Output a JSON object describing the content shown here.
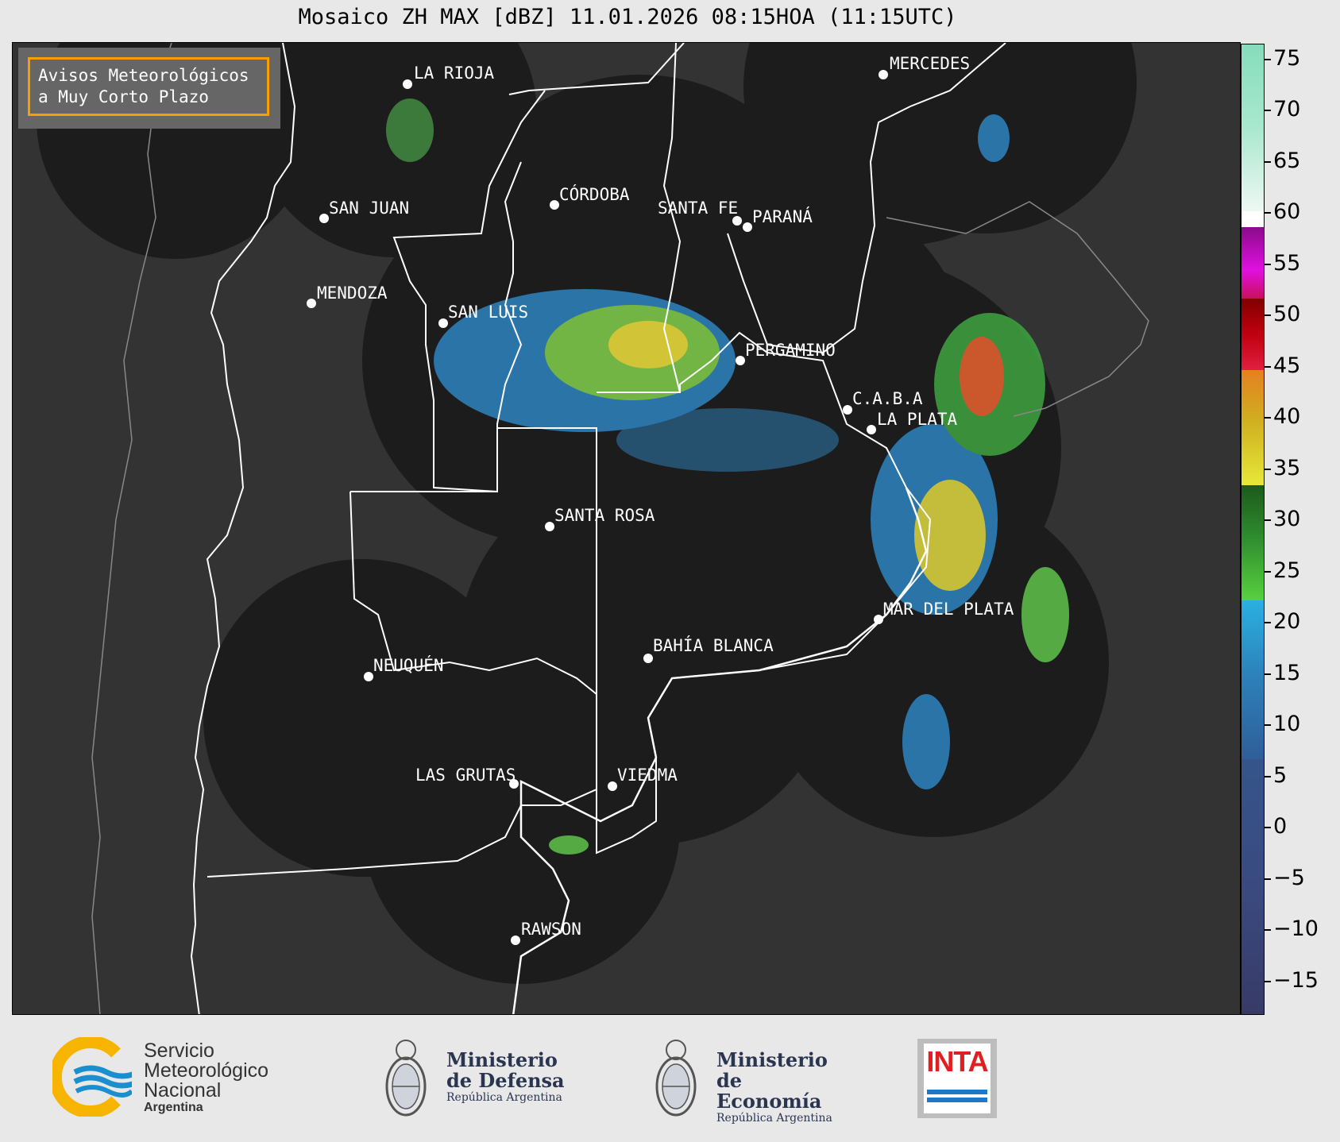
{
  "title": "Mosaico ZH MAX [dBZ] 11.01.2026 08:15HOA (11:15UTC)",
  "badge": {
    "line1": "Avisos Meteorológicos",
    "line2": "a Muy Corto Plazo"
  },
  "cities": [
    {
      "name": "LA RIOJA"
    },
    {
      "name": "MERCEDES"
    },
    {
      "name": "SAN JUAN"
    },
    {
      "name": "CÓRDOBA"
    },
    {
      "name": "SANTA FE"
    },
    {
      "name": "PARANÁ"
    },
    {
      "name": "MENDOZA"
    },
    {
      "name": "SAN LUIS"
    },
    {
      "name": "PERGAMINO"
    },
    {
      "name": "C.A.B.A"
    },
    {
      "name": "LA PLATA"
    },
    {
      "name": "SANTA ROSA"
    },
    {
      "name": "MAR DEL PLATA"
    },
    {
      "name": "BAHÍA BLANCA"
    },
    {
      "name": "NEUQUÉN"
    },
    {
      "name": "LAS GRUTAS"
    },
    {
      "name": "VIEDMA"
    },
    {
      "name": "RAWSON"
    }
  ],
  "colorbar": {
    "unit": "dBZ",
    "ticks": [
      "75",
      "70",
      "65",
      "60",
      "55",
      "50",
      "45",
      "40",
      "35",
      "30",
      "25",
      "20",
      "15",
      "10",
      "5",
      "0",
      "−5",
      "−10",
      "−15"
    ]
  },
  "logos": {
    "smn": {
      "line1": "Servicio",
      "line2": "Meteorológico",
      "line3": "Nacional",
      "line4": "Argentina",
      "icon": "smn-logo-icon"
    },
    "defensa": {
      "line1": "Ministerio",
      "line2": "de Defensa",
      "sub": "República Argentina",
      "icon": "argentina-coat-of-arms-icon"
    },
    "economia": {
      "line1": "Ministerio",
      "line2": "de Economía",
      "sub": "República Argentina",
      "icon": "argentina-coat-of-arms-icon"
    },
    "inta": {
      "text": "INTA",
      "icon": "inta-logo-icon"
    }
  }
}
